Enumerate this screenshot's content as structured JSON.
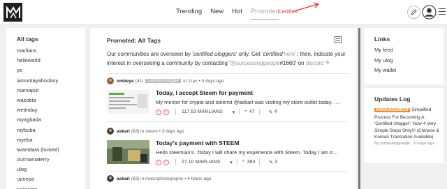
{
  "header": {
    "nav": [
      "Trending",
      "New",
      "Hot",
      "Promoted"
    ],
    "active_nav": "Promoted",
    "annotation": "Certified",
    "icons": [
      "logo",
      "pencil-icon",
      "user-avatar-icon",
      "hamburger-icon"
    ],
    "colors": {
      "annotation": "#e0312c",
      "accent": "#e8902c"
    }
  },
  "sidebar": {
    "title": "All tags",
    "tags": [
      "marlians",
      "helloworld",
      "ye",
      "iamnotayahooboy",
      "mamaput",
      "wazobia",
      "wetinday",
      "myagbada",
      "mybuba",
      "myeba",
      "iwantdata (locked)",
      "ourmamaterry",
      "ulog",
      "upnepa",
      "pajiarists"
    ]
  },
  "main": {
    "title": "Promoted: All Tags",
    "notice": {
      "p1": "Our communities are overseen by '",
      "em1": "certified uloggers",
      "p2": "' only. Get '",
      "em2": "certified",
      "here": "'here",
      "p3": "`; then, indicate your interest in overseeing a community by contacting '",
      "contact": "@surpassinggoogle",
      "p4": "#1660' on ",
      "discord": "discord"
    },
    "posts": [
      {
        "author": "ombeye",
        "rep": "(41)",
        "badge": "Certified Ulogger",
        "community": "in zzan",
        "time": "• 3 days ago",
        "title": "Today, I accept Steem for payment",
        "excerpt": "My mentor for crypto and steemit @askari was visiting my store outlet today. He n…",
        "amount": "117.63 MARLIANS",
        "votes": "47",
        "comments": "4"
      },
      {
        "author": "askari",
        "rep": "(63)",
        "badge": "",
        "community": "in steem",
        "time": "• 3 days ago",
        "title": "Today's payment with STEEM",
        "excerpt": "Hello steemian's. Today I will share my experience with Steem. Today I am trying t…",
        "amount": "27.10 MARLIANS",
        "votes": "394",
        "comments": "3"
      },
      {
        "author": "askari",
        "rep": "(63)",
        "badge": "",
        "community": "in macrophotography",
        "time": "• 4 hours ago",
        "title": "",
        "excerpt": "",
        "amount": "",
        "votes": "",
        "comments": ""
      }
    ]
  },
  "links": {
    "title": "Links",
    "items": [
      "My feed",
      "My ulog",
      "My wallet"
    ]
  },
  "updates": {
    "title": "Updates Log",
    "badge": "ANNOUNCEMENT",
    "text": "Simplified Process For Becoming A 'Certified Ulogger'; Now 4 Very-Simple Steps Only!!! (Chinese & Korean Translation Available)",
    "by": "By surpassinggoogle . 10 days ago"
  }
}
